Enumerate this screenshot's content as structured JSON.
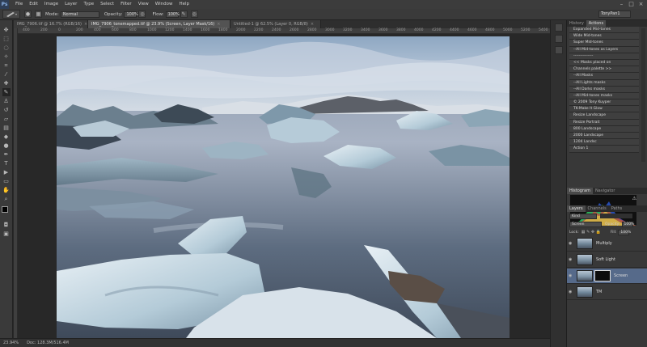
{
  "app": {
    "logo": "Ps",
    "menu": [
      "File",
      "Edit",
      "Image",
      "Layer",
      "Type",
      "Select",
      "Filter",
      "View",
      "Window",
      "Help"
    ],
    "window_controls": [
      "–",
      "□",
      "×"
    ]
  },
  "options_bar": {
    "mode_label": "Mode:",
    "mode_value": "Normal",
    "opacity_label": "Opacity:",
    "opacity_value": "100%",
    "flow_label": "Flow:",
    "flow_value": "100%",
    "workspace": "TonyPan1"
  },
  "doc_tabs": [
    {
      "label": "IMG_7906.tif @ 16.7% (RGB/16)",
      "close": "×",
      "active": false
    },
    {
      "label": "IMG_7906_tonemapped.tif @ 23.9% (Screen, Layer Mask/16)",
      "close": "×",
      "active": true
    },
    {
      "label": "Untitled-1 @ 62.5% (Layer 0, RGB/8)",
      "close": "×",
      "active": false
    }
  ],
  "ruler_ticks": [
    "400",
    "200",
    "0",
    "200",
    "400",
    "600",
    "800",
    "1000",
    "1200",
    "1400",
    "1600",
    "1800",
    "2000",
    "2200",
    "2400",
    "2600",
    "2800",
    "3000",
    "3200",
    "3400",
    "3600",
    "3800",
    "4000",
    "4200",
    "4400",
    "4600",
    "4800",
    "5000",
    "5200",
    "5400"
  ],
  "status": {
    "zoom": "23.94%",
    "doc": "Doc: 128.3M/516.4M"
  },
  "actions_panel": {
    "tabs": [
      "History",
      "Actions"
    ],
    "items": [
      "Expanded Mid-tones",
      "Wide Mid-tones",
      "Super Mid-tones",
      "--All Mid-tones as Layers",
      "---------------",
      "<< Masks placed on",
      "Channels palette >>",
      "--All Masks",
      "--All Lights masks",
      "--All Darks masks",
      "--All Mid-tones masks",
      "© 2009 Tony Kuyper",
      "TK-Make It Glow",
      "Resize Landscape",
      "Resize Portrait",
      "800 Landscape",
      "2000 Landscape",
      "1204 Landsc",
      "Action 1"
    ]
  },
  "histogram_panel": {
    "tabs": [
      "Histogram",
      "Navigator"
    ],
    "warning": "⚠"
  },
  "layers_panel": {
    "tabs": [
      "Layers",
      "Channels",
      "Paths"
    ],
    "kind_label": "Kind",
    "blend_mode": "Screen",
    "opacity_label": "Opacity:",
    "opacity_value": "100%",
    "lock_label": "Lock:",
    "fill_label": "Fill:",
    "fill_value": "100%",
    "layers": [
      {
        "name": "Multiply",
        "selected": false,
        "mask": false
      },
      {
        "name": "Soft Light",
        "selected": false,
        "mask": false
      },
      {
        "name": "Screen",
        "selected": true,
        "mask": true
      },
      {
        "name": "TM",
        "selected": false,
        "mask": false
      }
    ]
  }
}
